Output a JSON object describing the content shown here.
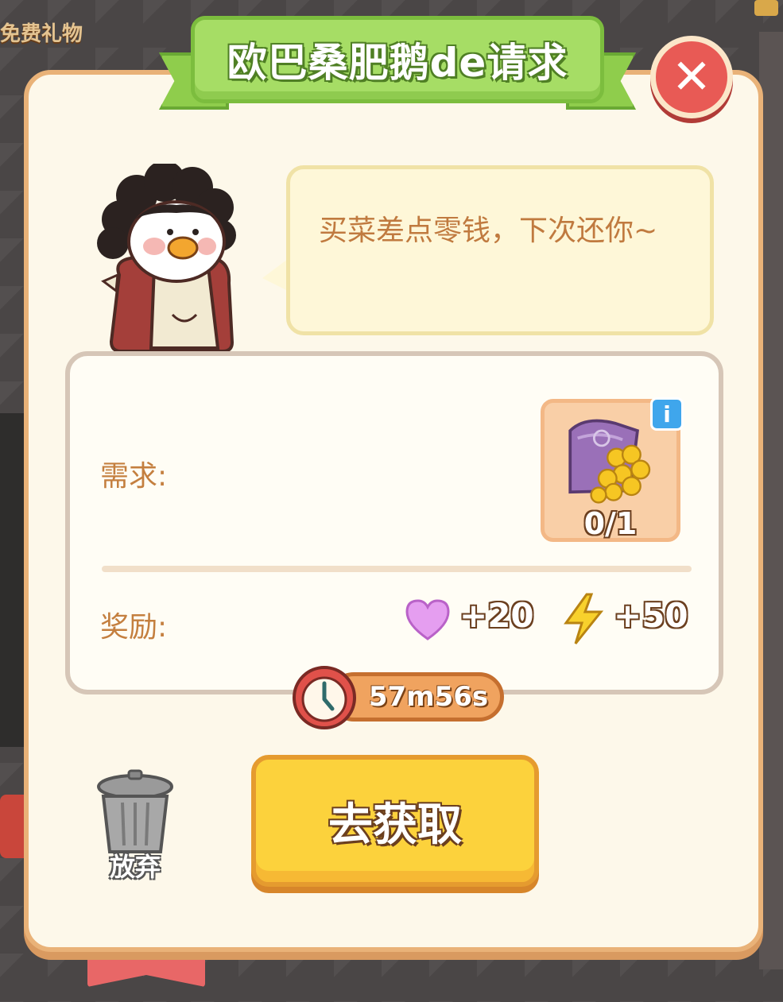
{
  "background": {
    "gift_label": "免费礼物"
  },
  "dialog": {
    "title": "欧巴桑肥鹅de请求",
    "speech": "买菜差点零钱，下次还你~",
    "need_label": "需求:",
    "item_progress": "0/1",
    "reward_label": "奖励:",
    "rewards": {
      "heart": "+20",
      "energy": "+50"
    },
    "timer": "57m56s",
    "discard_label": "放弃",
    "go_button": "去获取"
  },
  "colors": {
    "panel_bg": "#fdf8ea",
    "panel_border": "#e9b278",
    "banner_green": "#a6dd65",
    "close_red": "#e85a55",
    "go_yellow": "#fcd23c",
    "text_brown": "#c47f3f"
  },
  "icons": [
    "close-icon",
    "info-icon",
    "coin-bag-icon",
    "heart-icon",
    "lightning-icon",
    "clock-icon",
    "trash-icon"
  ]
}
